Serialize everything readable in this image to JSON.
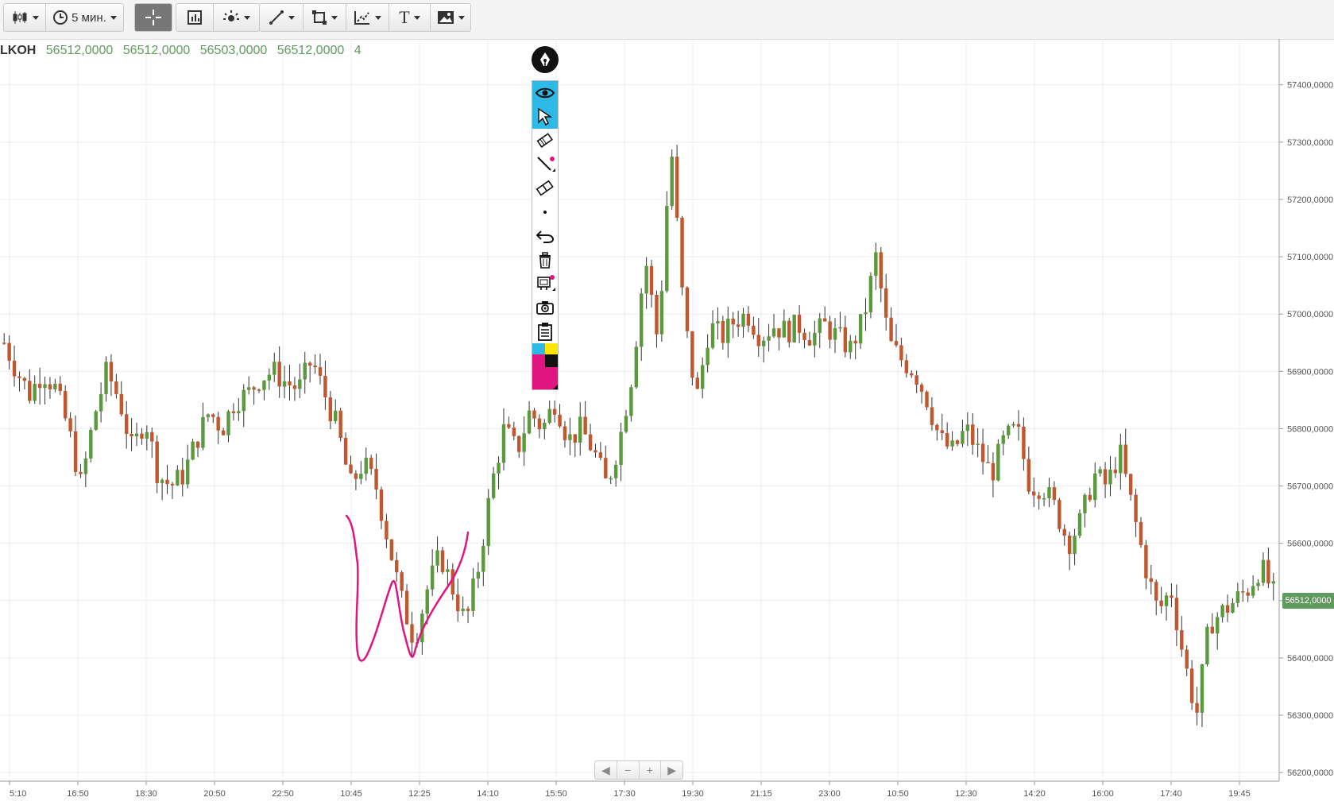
{
  "toolbar": {
    "interval_label": "5 мин.",
    "text_tool_label": "T"
  },
  "ohlc": {
    "symbol": "LKOH",
    "open": "56512,0000",
    "high": "56512,0000",
    "low": "56503,0000",
    "close": "56512,0000",
    "volume": "4"
  },
  "colors": {
    "up": "#5a9a3c",
    "down": "#c0572e",
    "wick": "#333333",
    "drawing": "#e0157f",
    "selected_tool": "#2fb9e6",
    "price_tag": "#5f9b5f"
  },
  "drawing_toolbar": {
    "items": [
      "eye-icon",
      "cursor-icon",
      "marker-icon",
      "line-icon",
      "eraser-icon",
      "dot-icon",
      "undo-icon",
      "trash-icon",
      "stamp-icon",
      "camera-icon",
      "clipboard-icon",
      "palette-icon"
    ]
  },
  "nav": {
    "prev": "◀",
    "zoom_out": "−",
    "zoom_in": "+",
    "next": "▶"
  },
  "last_price_label": "56512,0000",
  "chart_data": {
    "type": "candlestick",
    "y_axis": {
      "labels": [
        "57400,0000",
        "57300,0000",
        "57200,0000",
        "57100,0000",
        "57000,0000",
        "56900,0000",
        "56800,0000",
        "56700,0000",
        "56600,0000",
        "56500,0000",
        "56400,0000",
        "56300,0000",
        "56200,0000"
      ],
      "values": [
        57400,
        57300,
        57200,
        57100,
        57000,
        56900,
        56800,
        56700,
        56600,
        56500,
        56400,
        56300,
        56200
      ],
      "range": [
        56185,
        57480
      ]
    },
    "x_axis": {
      "labels": [
        "5:10",
        "16:50",
        "18:30",
        "20:50",
        "22:50",
        "10:45",
        "12:25",
        "14:10",
        "15:50",
        "17:30",
        "19:30",
        "21:15",
        "23:00",
        "10:50",
        "12:30",
        "14:20",
        "16:00",
        "17:40",
        "19:45"
      ]
    },
    "grid": true,
    "last_price": 56512,
    "price_path": [
      56950,
      56900,
      56860,
      56900,
      56870,
      56800,
      56700,
      56820,
      56900,
      56850,
      56760,
      56820,
      56720,
      56700,
      56720,
      56780,
      56830,
      56800,
      56850,
      56860,
      56890,
      56900,
      56880,
      56870,
      56920,
      56860,
      56800,
      56700,
      56740,
      56700,
      56600,
      56500,
      56430,
      56520,
      56580,
      56520,
      56460,
      56560,
      56700,
      56800,
      56760,
      56830,
      56800,
      56850,
      56780,
      56800,
      56760,
      56700,
      56780,
      56900,
      57100,
      56950,
      57300,
      57000,
      56850,
      56980,
      56960,
      56990,
      57000,
      56960,
      56980,
      56970,
      56980,
      56960,
      56980,
      56960,
      56940,
      56990,
      57100,
      56950,
      56920,
      56900,
      56850,
      56780,
      56760,
      56800,
      56760,
      56720,
      56780,
      56800,
      56700,
      56700,
      56660,
      56600,
      56640,
      56720,
      56700,
      56760,
      56660,
      56560,
      56480,
      56520,
      56400,
      56300,
      56460,
      56480,
      56500,
      56520,
      56560,
      56512
    ]
  }
}
